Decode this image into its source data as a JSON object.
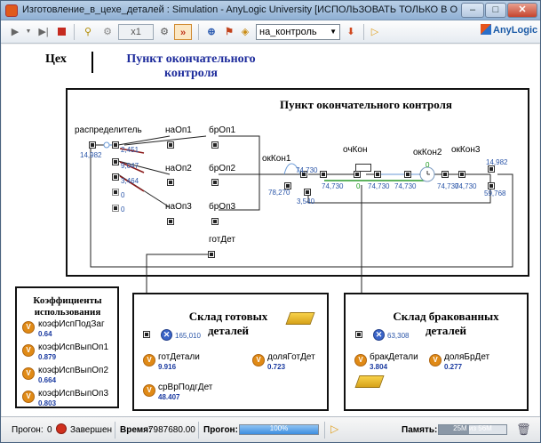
{
  "window": {
    "title": "Изготовление_в_цехе_деталей : Simulation - AnyLogic University  [ИСПОЛЬЗОВАТЬ ТОЛЬКО В ОБРАЗОВАТЕЛЬ...",
    "min_label": "–",
    "max_label": "□",
    "close_label": "✕"
  },
  "toolbar": {
    "speed_value": "x1",
    "experiment_selected": "на_контроль",
    "logo_label": "AnyLogic"
  },
  "header": {
    "workshop_label": "Цех",
    "section_title": "Пункт окончательного контроля"
  },
  "control_box": {
    "title": "Пункт окончательного контроля",
    "blocks": {
      "distributor": "распределитель",
      "naOp1": "наОп1",
      "naOp2": "наОп2",
      "naOp3": "наОп3",
      "brOp1": "брОп1",
      "brOp2": "брОп2",
      "brOp3": "брОп3",
      "gotDet": "готДет",
      "okKon1": "окКон1",
      "ochKon": "очКон",
      "okKon2": "окКон2",
      "okKon3": "окКон3"
    },
    "counts": {
      "distributor_in": "14,982",
      "out1": "2,451",
      "out2": "9,047",
      "out3": "3,464",
      "out4": "0",
      "out5": "0",
      "okKon1_in": "78,270",
      "okKon1_top": "74,730",
      "okKon1_bottom": "3,540",
      "q_left": "74,730",
      "q_mid": "0",
      "q_right1": "74,730",
      "q_right2": "74,730",
      "okKon2_count": "0",
      "okKon3_left": "74,730",
      "okKon3_right": "74,730",
      "okKon3_top": "14,982",
      "okKon3_bottom": "59,768"
    }
  },
  "utilization": {
    "title": "Коэффициенты использования",
    "items": [
      {
        "name": "коэфИспПодЗаг",
        "value": "0.64"
      },
      {
        "name": "коэфИспВыпОп1",
        "value": "0.879"
      },
      {
        "name": "коэфИспВыпОп2",
        "value": "0.664"
      },
      {
        "name": "коэфИспВыпОп3",
        "value": "0.803"
      }
    ]
  },
  "finished_store": {
    "title": "Склад готовых деталей",
    "sink_count": "165,010",
    "vars": [
      {
        "name": "готДетали",
        "value": "9.916"
      },
      {
        "name": "доляГотДет",
        "value": "0.723"
      },
      {
        "name": "срВрПодгДет",
        "value": "48.407"
      }
    ]
  },
  "defect_store": {
    "title": "Склад бракованных деталей",
    "sink_count": "63,308",
    "vars": [
      {
        "name": "бракДетали",
        "value": "3.804"
      },
      {
        "name": "доляБрДет",
        "value": "0.277"
      }
    ]
  },
  "status": {
    "runs_label": "Прогон:",
    "runs_value": "0",
    "state": "Завершен",
    "time_label": "Время:",
    "time_value": "7987680.00",
    "progress_label": "Прогон:",
    "progress_text": "100%",
    "progress_value": 1.0,
    "memory_label": "Память:",
    "memory_text": "25M из 56M",
    "memory_value": 0.45
  },
  "colors": {
    "accent_blue": "#1e2c9c",
    "count_blue": "#2a55a8",
    "variable_orange": "#e08a16",
    "sink_blue": "#3a64c8"
  }
}
